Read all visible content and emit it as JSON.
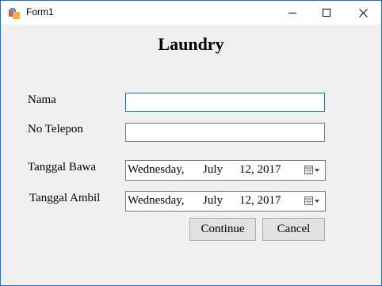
{
  "window": {
    "title": "Form1"
  },
  "form": {
    "heading": "Laundry",
    "nama_label": "Nama",
    "telepon_label": "No Telepon",
    "tanggal_bawa_label": "Tanggal Bawa",
    "tanggal_ambil_label": "Tanggal Ambil",
    "nama_value": "",
    "telepon_value": "",
    "tanggal_bawa": {
      "day": "Wednesday,",
      "month": "July",
      "date": "12, 2017"
    },
    "tanggal_ambil": {
      "day": "Wednesday,",
      "month": "July",
      "date": "12, 2017"
    },
    "continue_label": "Continue",
    "cancel_label": "Cancel"
  }
}
